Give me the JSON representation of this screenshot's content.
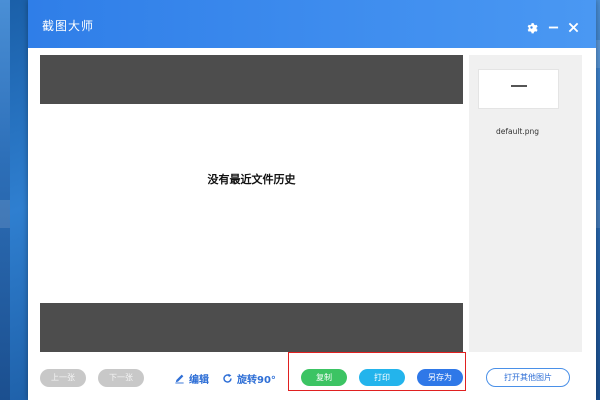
{
  "app": {
    "title": "截图大师"
  },
  "titlebar": {
    "settings_icon": "gear-icon",
    "minimize_icon": "minimize-icon",
    "close_icon": "close-icon"
  },
  "preview": {
    "empty_message": "没有最近文件历史"
  },
  "history": {
    "items": [
      {
        "label": "default.png"
      }
    ]
  },
  "toolbar": {
    "prev_label": "上一张",
    "next_label": "下一张",
    "edit_label": "编辑",
    "rotate_label": "旋转90°",
    "copy_label": "复制",
    "print_label": "打印",
    "saveas_label": "另存为",
    "open_other_label": "打开其他图片"
  },
  "colors": {
    "titlebar_start": "#2f7ee8",
    "titlebar_end": "#4a98f3",
    "copy_button": "#3cc463",
    "print_button": "#23b4ec",
    "saveas_button": "#2f78e8",
    "link_blue": "#2f6fd6",
    "highlight_red": "#e02020"
  }
}
